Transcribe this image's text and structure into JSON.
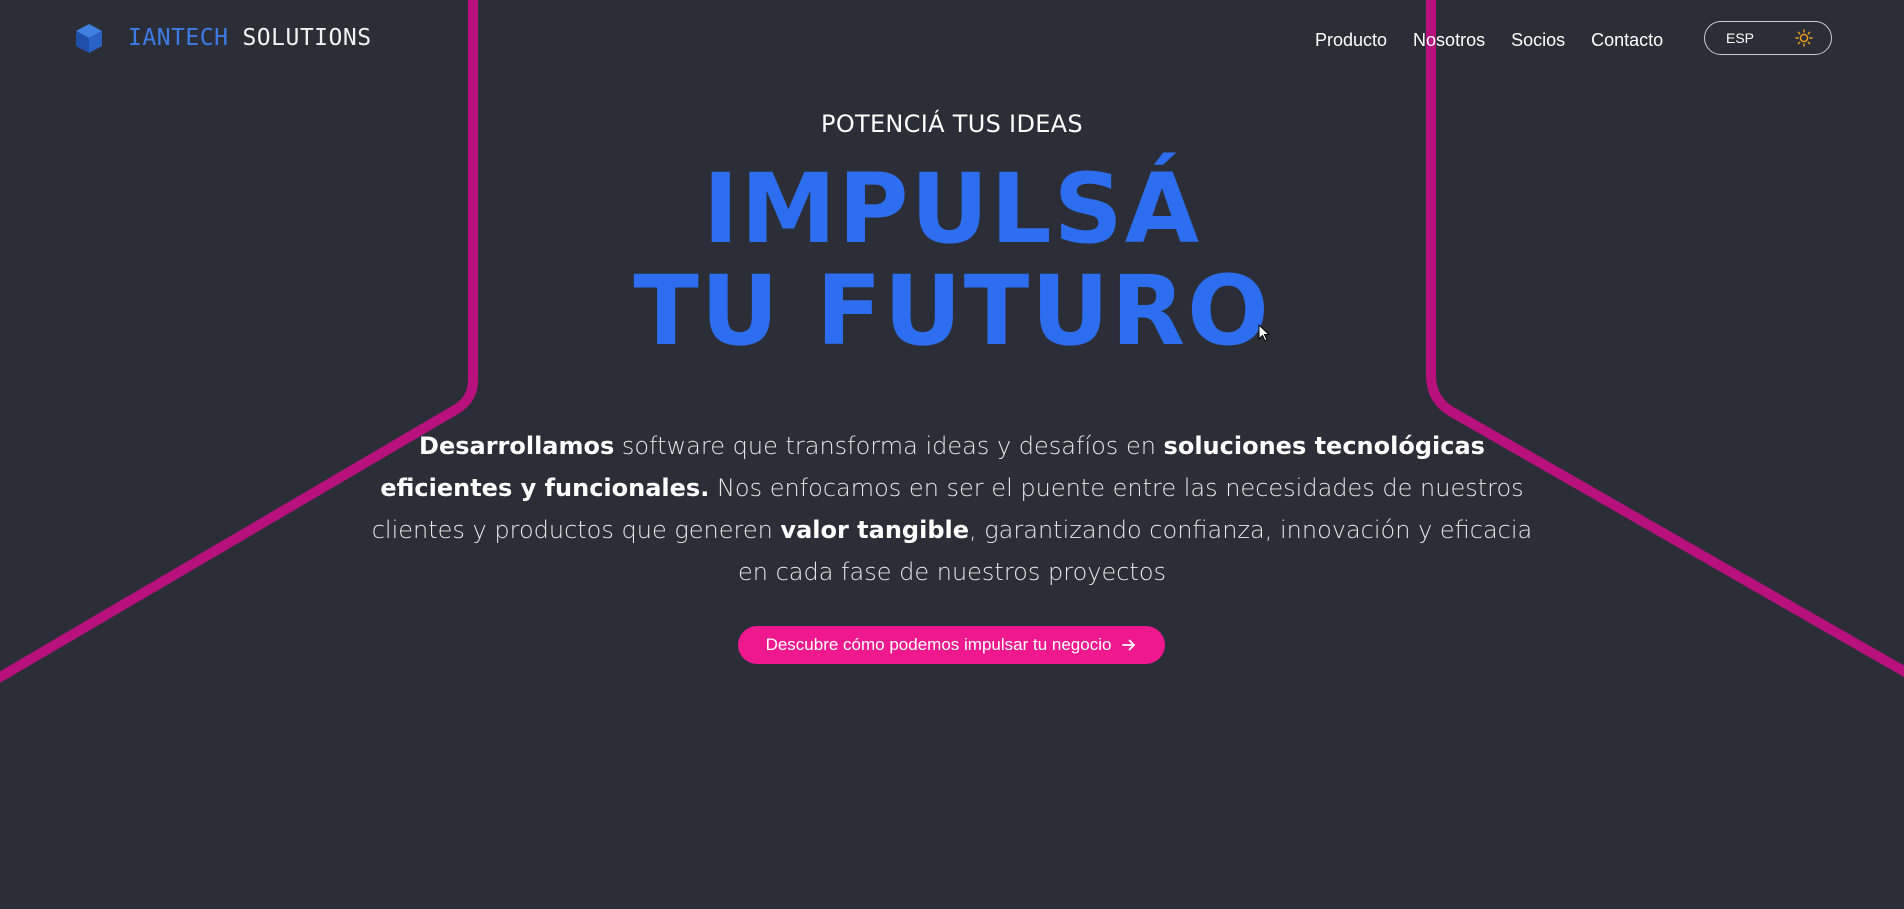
{
  "colors": {
    "background": "#2b2e37",
    "accent_blue": "#2d6ef0",
    "accent_pink": "#f0188f",
    "line_magenta": "#b8117d"
  },
  "header": {
    "logo_icon": "cube-icon",
    "logo_text_primary": "IANTECH",
    "logo_text_secondary": "SOLUTIONS",
    "nav": [
      "Producto",
      "Nosotros",
      "Socios",
      "Contacto"
    ],
    "language": "ESP",
    "theme_icon": "sun-icon"
  },
  "hero": {
    "eyebrow": "POTENCIÁ TUS IDEAS",
    "headline_line1": "IMPULSÁ",
    "headline_line2": "TU FUTURO",
    "description": {
      "s1": "Desarrollamos",
      "s2": " software que transforma ideas y desafíos en ",
      "s3": "soluciones tecnológicas eficientes y funcionales.",
      "s4": " Nos enfocamos en ser el puente entre las necesidades de nuestros clientes y productos que generen ",
      "s5": "valor tangible",
      "s6": ", garantizando confianza, innovación y eficacia en cada fase de nuestros proyectos"
    },
    "cta_label": "Descubre cómo podemos impulsar tu negocio",
    "cta_icon": "arrow-right-icon"
  }
}
